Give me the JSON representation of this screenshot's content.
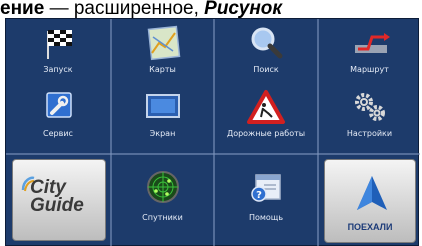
{
  "caption": {
    "part1": "ение",
    "part2": " — расширенное, ",
    "part3": "Рисунок"
  },
  "menu": {
    "items": [
      {
        "label": "Запуск",
        "icon": "checkered-flag-icon"
      },
      {
        "label": "Карты",
        "icon": "map-icon"
      },
      {
        "label": "Поиск",
        "icon": "magnifier-icon"
      },
      {
        "label": "Маршрут",
        "icon": "route-icon"
      },
      {
        "label": "Сервис",
        "icon": "wrench-icon"
      },
      {
        "label": "Экран",
        "icon": "screen-icon"
      },
      {
        "label": "Дорожные работы",
        "icon": "road-works-sign-icon"
      },
      {
        "label": "Настройки",
        "icon": "gears-icon"
      },
      {
        "label": "Спутники",
        "icon": "satellite-radar-icon"
      },
      {
        "label": "Помощь",
        "icon": "help-window-icon"
      }
    ],
    "city_guide": {
      "line1": "City",
      "line2": "Guide"
    },
    "go_button": {
      "label": "ПОЕХАЛИ"
    }
  },
  "colors": {
    "panel_bg": "#1d3b6b",
    "grid_line": "#7f97bf",
    "go_arrow": "#1f5fb8",
    "road_sign_red": "#d22020"
  }
}
